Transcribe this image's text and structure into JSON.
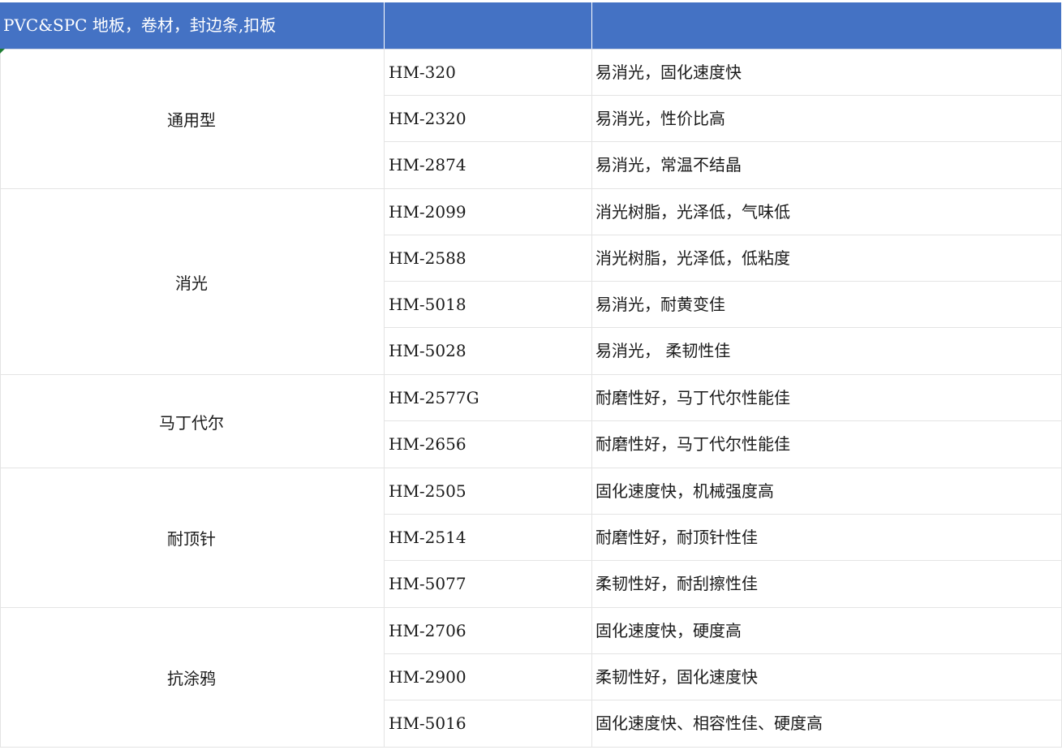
{
  "header": {
    "col1": "PVC&SPC 地板，卷材，封边条,扣板",
    "col2": "",
    "col3": ""
  },
  "groups": [
    {
      "category": "通用型",
      "rows": [
        {
          "code": "HM-320",
          "desc": "易消光，固化速度快"
        },
        {
          "code": "HM-2320",
          "desc": "易消光，性价比高"
        },
        {
          "code": "HM-2874",
          "desc": "易消光，常温不结晶"
        }
      ]
    },
    {
      "category": "消光",
      "rows": [
        {
          "code": "HM-2099",
          "desc": "消光树脂，光泽低，气味低"
        },
        {
          "code": "HM-2588",
          "desc": "消光树脂，光泽低，低粘度"
        },
        {
          "code": "HM-5018",
          "desc": "易消光，耐黄变佳"
        },
        {
          "code": "HM-5028",
          "desc": "易消光， 柔韧性佳"
        }
      ]
    },
    {
      "category": "马丁代尔",
      "rows": [
        {
          "code": "HM-2577G",
          "desc": "耐磨性好，马丁代尔性能佳"
        },
        {
          "code": "HM-2656",
          "desc": "耐磨性好，马丁代尔性能佳"
        }
      ]
    },
    {
      "category": "耐顶针",
      "rows": [
        {
          "code": "HM-2505",
          "desc": "固化速度快，机械强度高"
        },
        {
          "code": "HM-2514",
          "desc": "耐磨性好，耐顶针性佳"
        },
        {
          "code": "HM-5077",
          "desc": "柔韧性好，耐刮擦性佳"
        }
      ]
    },
    {
      "category": "抗涂鸦",
      "rows": [
        {
          "code": "HM-2706",
          "desc": "固化速度快，硬度高"
        },
        {
          "code": "HM-2900",
          "desc": "柔韧性好，固化速度快"
        },
        {
          "code": "HM-5016",
          "desc": "固化速度快、相容性佳、硬度高"
        }
      ]
    }
  ],
  "colors": {
    "header_bg": "#4472c4",
    "header_text": "#ffffff",
    "grid": "#e4e4e4"
  }
}
